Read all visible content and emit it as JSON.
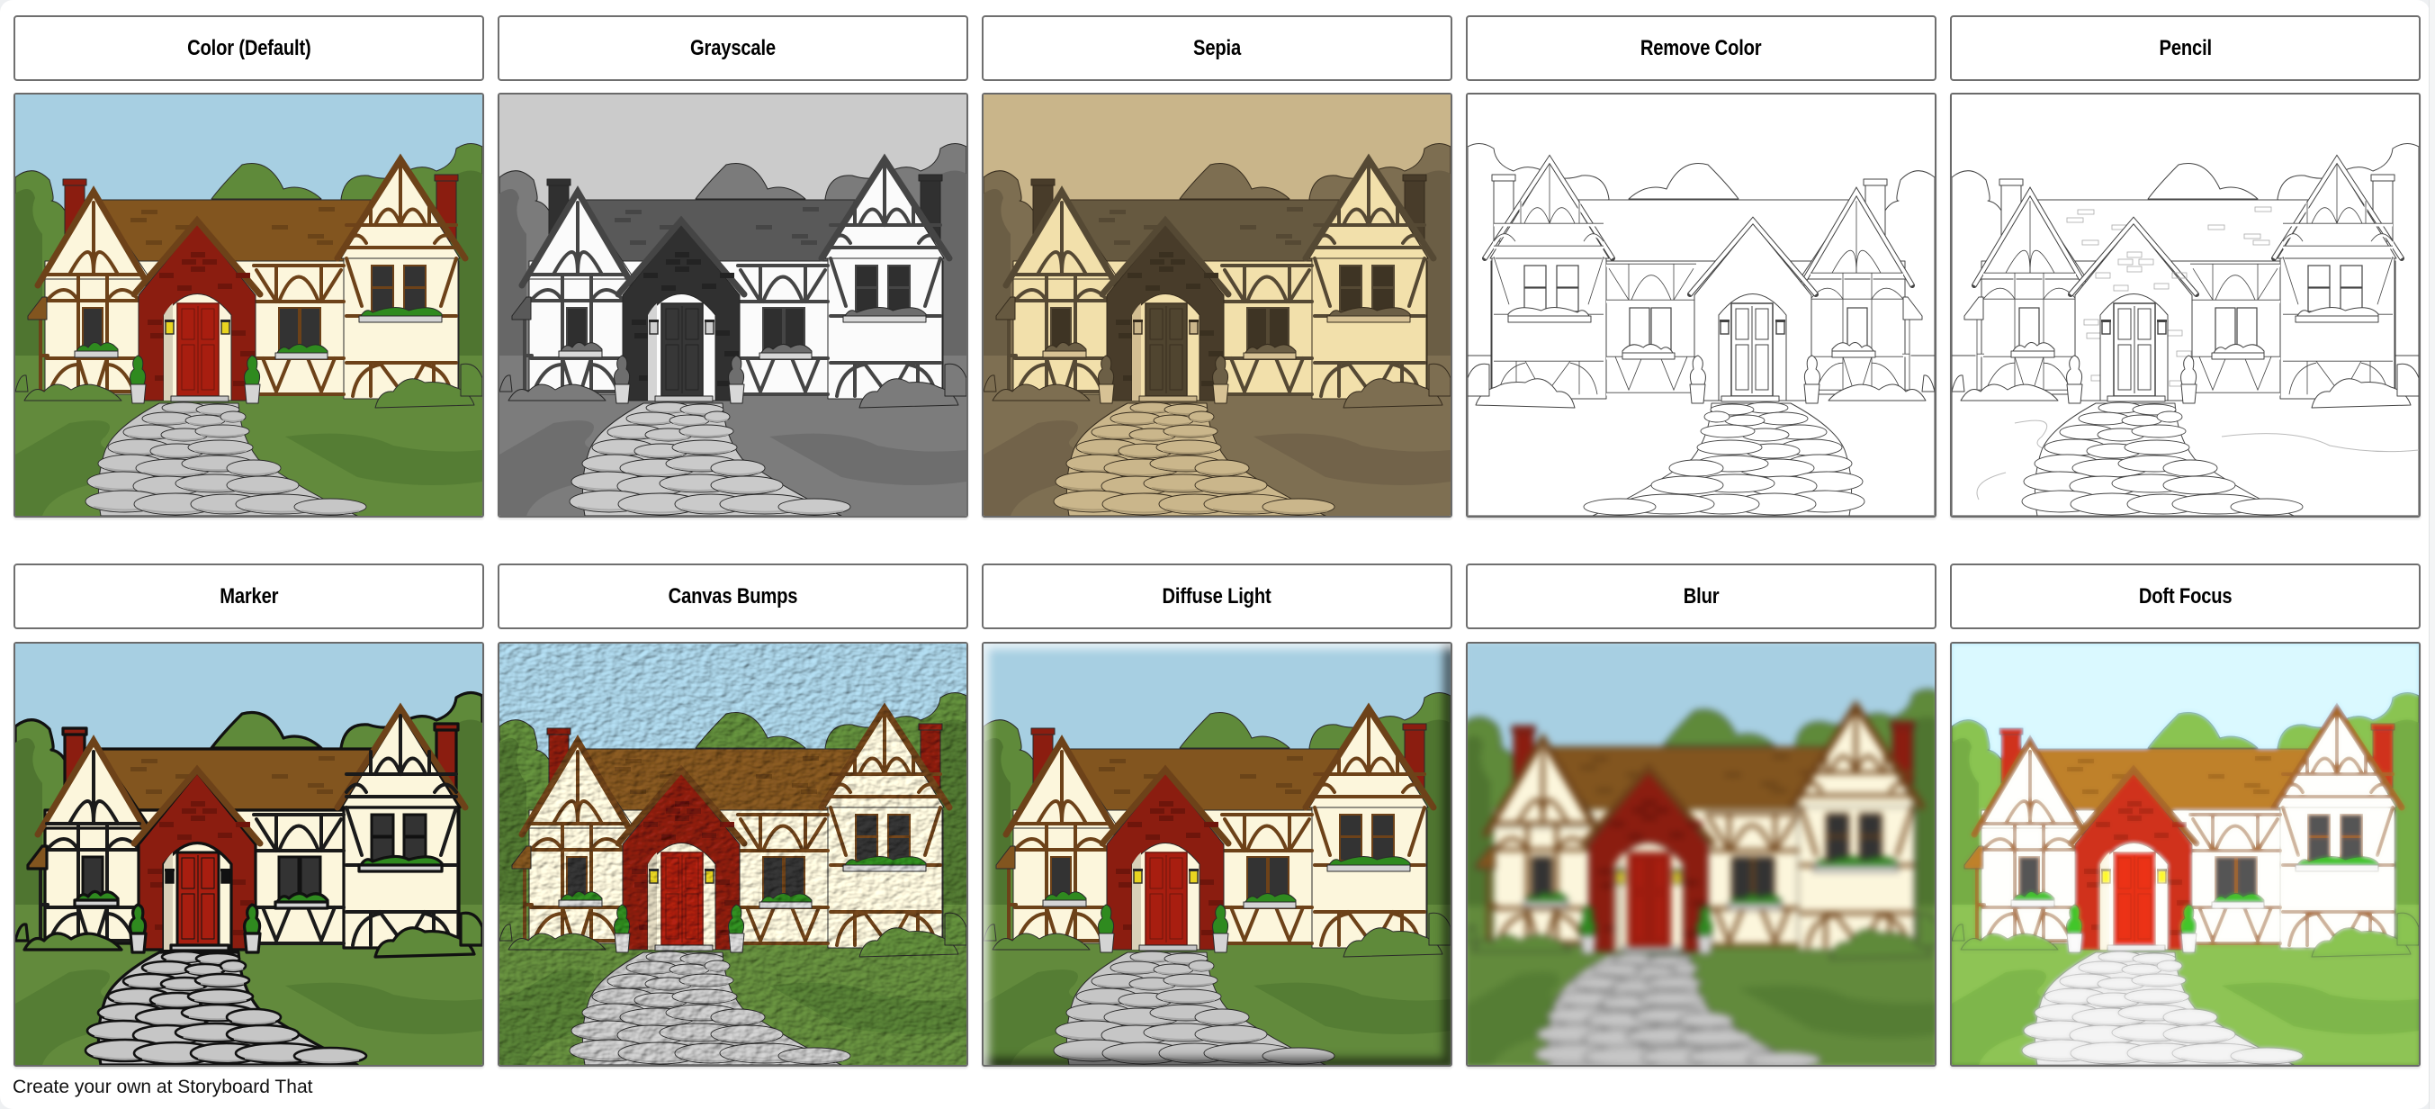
{
  "panels": [
    {
      "label": "Color (Default)",
      "effect": "color"
    },
    {
      "label": "Grayscale",
      "effect": "grayscale"
    },
    {
      "label": "Sepia",
      "effect": "sepia"
    },
    {
      "label": "Remove Color",
      "effect": "remove-color"
    },
    {
      "label": "Pencil",
      "effect": "pencil"
    },
    {
      "label": "Marker",
      "effect": "marker"
    },
    {
      "label": "Canvas Bumps",
      "effect": "canvas-bumps"
    },
    {
      "label": "Diffuse Light",
      "effect": "diffuse-light"
    },
    {
      "label": "Blur",
      "effect": "blur"
    },
    {
      "label": "Doft Focus",
      "effect": "soft-focus"
    }
  ],
  "scene": {
    "subject": "tudor-house",
    "colors": {
      "sky": "#a7cfe2",
      "tree_light": "#5f8a3a",
      "tree_dark": "#4f7530",
      "grass": "#628a3c",
      "grass_dark": "#557d34",
      "roof": "#82551f",
      "roof_brick": "#6b4418",
      "timber": "#6d4219",
      "plaster": "#fcf6dc",
      "brick": "#8b1d10",
      "brick_dark": "#6e150b",
      "door": "#a81e10",
      "window": "#333333",
      "stone": "#c6c6c6",
      "stone_shadow": "#a9a9a9",
      "lantern": "#e8d420",
      "planter_leaf": "#2f8a1f",
      "pot": "#d4d4d4"
    }
  },
  "footer": {
    "text": "Create your own at Storyboard That"
  }
}
